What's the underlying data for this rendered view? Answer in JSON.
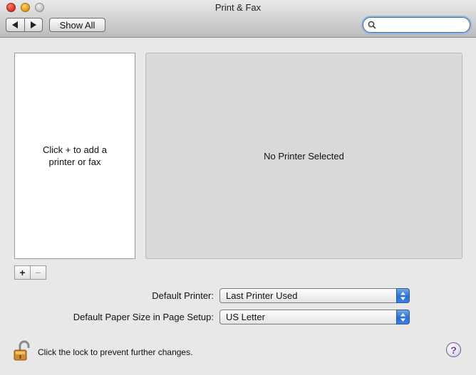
{
  "window": {
    "title": "Print & Fax"
  },
  "toolbar": {
    "back_icon": "triangle-left-icon",
    "forward_icon": "triangle-right-icon",
    "show_all_label": "Show All",
    "search": {
      "value": "",
      "placeholder": ""
    }
  },
  "printers": {
    "empty_hint": "Click + to add a\nprinter or fax",
    "add_label": "+",
    "remove_label": "−"
  },
  "detail": {
    "status_text": "No Printer Selected"
  },
  "settings": {
    "default_printer": {
      "label": "Default Printer:",
      "value": "Last Printer Used"
    },
    "paper_size": {
      "label": "Default Paper Size in Page Setup:",
      "value": "US Letter"
    }
  },
  "footer": {
    "lock_text": "Click the lock to prevent further changes.",
    "help_label": "?"
  },
  "colors": {
    "accent": "#3d82e0",
    "window_bg": "#e8e8e8",
    "pane_bg": "#d9d9d9"
  }
}
